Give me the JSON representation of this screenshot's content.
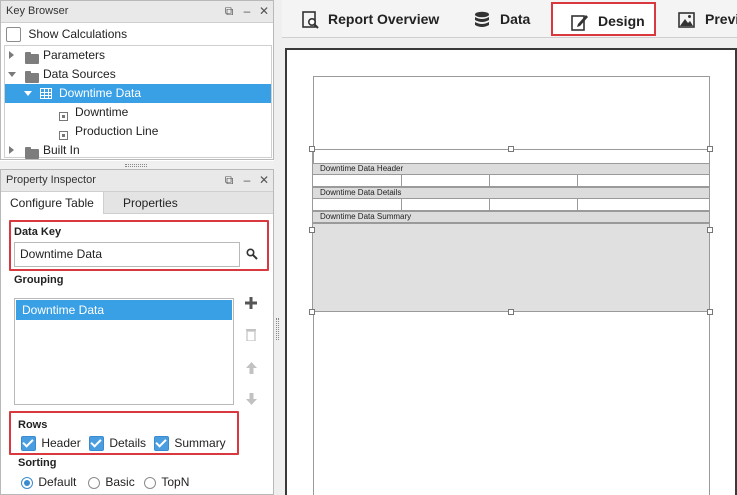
{
  "key_browser": {
    "title": "Key Browser",
    "show_calculations": "Show Calculations",
    "tree": {
      "parameters": "Parameters",
      "data_sources": "Data Sources",
      "downtime_data": "Downtime Data",
      "downtime": "Downtime",
      "production_line": "Production Line",
      "built_in": "Built In"
    }
  },
  "property_inspector": {
    "title": "Property Inspector",
    "tabs": [
      "Configure Table",
      "Properties"
    ],
    "data_key_label": "Data Key",
    "data_key_value": "Downtime Data",
    "grouping_label": "Grouping",
    "grouping_items": [
      "Downtime Data"
    ],
    "rows_label": "Rows",
    "rows": {
      "header": "Header",
      "details": "Details",
      "summary": "Summary"
    },
    "sorting_label": "Sorting",
    "sorting": {
      "default": "Default",
      "basic": "Basic",
      "topn": "TopN"
    }
  },
  "main_tabs": [
    "Report Overview",
    "Data",
    "Design",
    "Preview"
  ],
  "canvas": {
    "band_header": "Downtime Data Header",
    "band_details": "Downtime Data Details",
    "band_summary": "Downtime Data Summary"
  },
  "colors": {
    "selection": "#3aa0e6",
    "highlight_box": "#d9383f",
    "checkbox": "#4a9ee0"
  }
}
